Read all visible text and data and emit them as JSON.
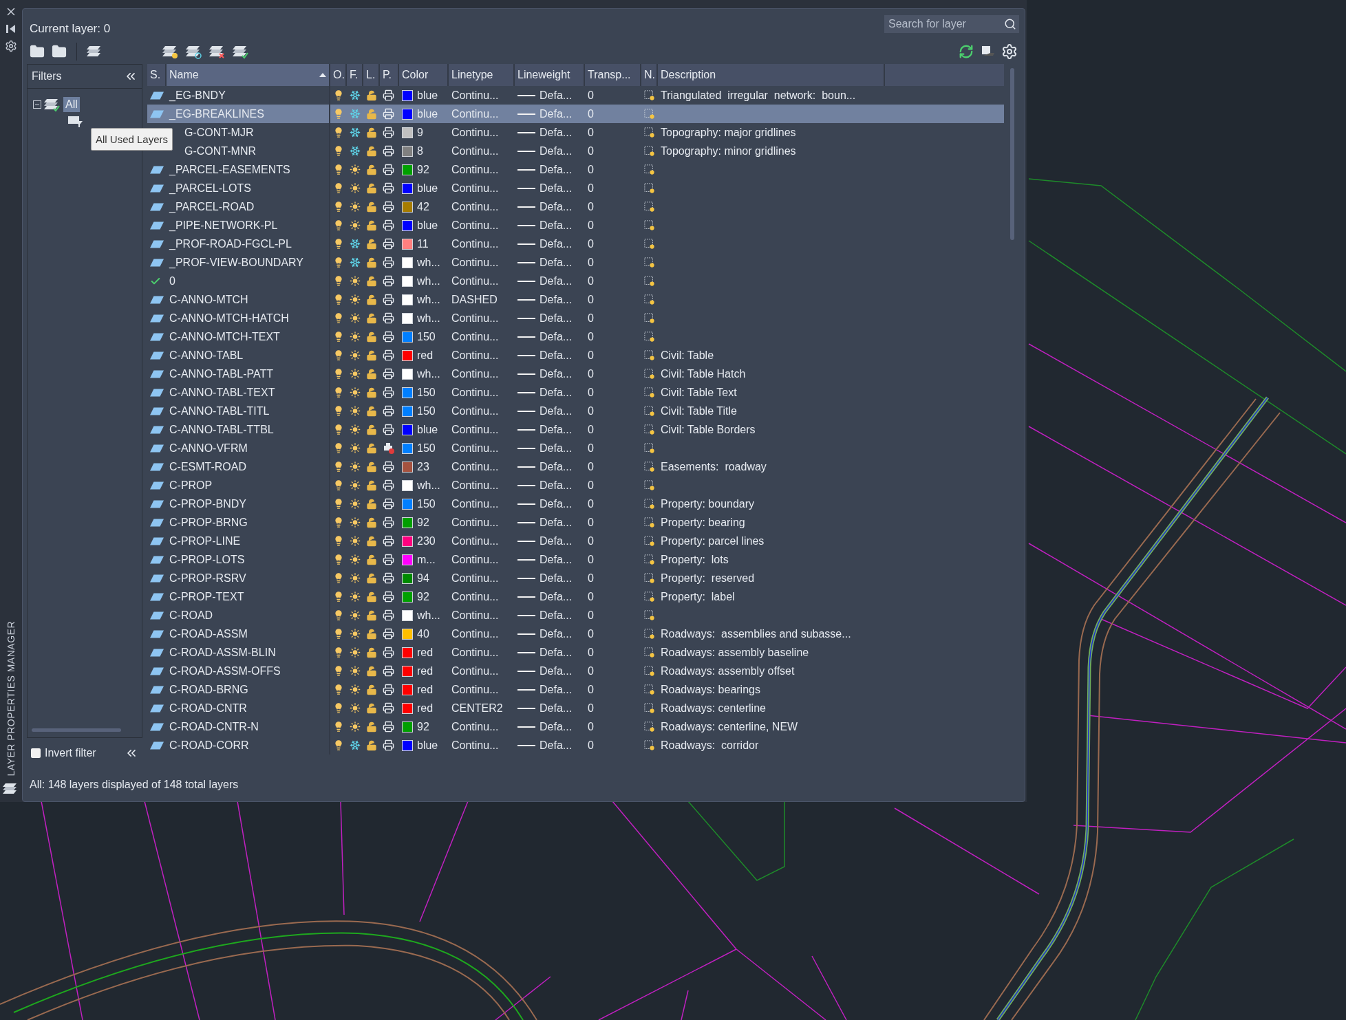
{
  "window": {
    "side_title": "LAYER PROPERTIES MANAGER"
  },
  "current_layer": "Current layer: 0",
  "search": {
    "placeholder": "Search for layer"
  },
  "filters": {
    "title": "Filters",
    "tree": [
      {
        "label": "All",
        "selected": true,
        "expanded": true,
        "children": [
          {
            "kind": "used-filter"
          }
        ]
      }
    ]
  },
  "tooltip": "All Used Layers",
  "invert_filter": {
    "label": "Invert filter",
    "checked": false
  },
  "columns": [
    {
      "label": "S.",
      "sorted": false
    },
    {
      "label": "Name",
      "sorted": true
    },
    {
      "label": "O.",
      "sorted": false
    },
    {
      "label": "F.",
      "sorted": false
    },
    {
      "label": "L.",
      "sorted": false
    },
    {
      "label": "P.",
      "sorted": false
    },
    {
      "label": "Color",
      "sorted": false
    },
    {
      "label": "Linetype",
      "sorted": false
    },
    {
      "label": "Lineweight",
      "sorted": false
    },
    {
      "label": "Transp...",
      "sorted": false
    },
    {
      "label": "N.",
      "sorted": false
    },
    {
      "label": "Description",
      "sorted": false
    }
  ],
  "rows": [
    {
      "kind": "layer",
      "name": "_EG-BNDY",
      "on": true,
      "frozen": true,
      "locked": false,
      "plot": true,
      "color": "#0000ff",
      "color_label": "blue",
      "linetype": "Continu...",
      "lineweight": "Defa...",
      "transparency": "0",
      "description": "Triangulated  irregular  network:  boun...",
      "selected": false
    },
    {
      "kind": "layer",
      "name": "_EG-BREAKLINES",
      "on": true,
      "frozen": true,
      "locked": false,
      "plot": true,
      "color": "#0000ff",
      "color_label": "blue",
      "linetype": "Continu...",
      "lineweight": "Defa...",
      "transparency": "0",
      "selected": true
    },
    {
      "kind": "covered",
      "name": "G-CONT-MJR",
      "on": true,
      "frozen": true,
      "locked": false,
      "plot": true,
      "color": "#c0c0c0",
      "color_label": "9",
      "linetype": "Continu...",
      "lineweight": "Defa...",
      "transparency": "0",
      "description": "Topography: major gridlines",
      "selected": false
    },
    {
      "kind": "covered",
      "name": "G-CONT-MNR",
      "on": true,
      "frozen": true,
      "locked": false,
      "plot": true,
      "color": "#808080",
      "color_label": "8",
      "linetype": "Continu...",
      "lineweight": "Defa...",
      "transparency": "0",
      "description": "Topography: minor gridlines",
      "selected": false
    },
    {
      "kind": "layer",
      "name": "_PARCEL-EASEMENTS",
      "on": true,
      "frozen": false,
      "locked": false,
      "plot": true,
      "color": "#00a000",
      "color_label": "92",
      "linetype": "Continu...",
      "lineweight": "Defa...",
      "transparency": "0",
      "selected": false
    },
    {
      "kind": "layer",
      "name": "_PARCEL-LOTS",
      "on": true,
      "frozen": false,
      "locked": false,
      "plot": true,
      "color": "#0000ff",
      "color_label": "blue",
      "linetype": "Continu...",
      "lineweight": "Defa...",
      "transparency": "0",
      "selected": false
    },
    {
      "kind": "layer",
      "name": "_PARCEL-ROAD",
      "on": true,
      "frozen": false,
      "locked": false,
      "plot": true,
      "color": "#a67c00",
      "color_label": "42",
      "linetype": "Continu...",
      "lineweight": "Defa...",
      "transparency": "0",
      "selected": false
    },
    {
      "kind": "layer",
      "name": "_PIPE-NETWORK-PL",
      "on": true,
      "frozen": false,
      "locked": false,
      "plot": true,
      "color": "#0000ff",
      "color_label": "blue",
      "linetype": "Continu...",
      "lineweight": "Defa...",
      "transparency": "0",
      "selected": false
    },
    {
      "kind": "layer",
      "name": "_PROF-ROAD-FGCL-PL",
      "on": true,
      "frozen": true,
      "locked": false,
      "plot": true,
      "color": "#ff7f7f",
      "color_label": "11",
      "linetype": "Continu...",
      "lineweight": "Defa...",
      "transparency": "0",
      "selected": false
    },
    {
      "kind": "layer",
      "name": "_PROF-VIEW-BOUNDARY",
      "on": true,
      "frozen": true,
      "locked": false,
      "plot": true,
      "color": "#ffffff",
      "color_label": "wh...",
      "linetype": "Continu...",
      "lineweight": "Defa...",
      "transparency": "0",
      "selected": false
    },
    {
      "kind": "current",
      "name": "0",
      "on": true,
      "frozen": false,
      "locked": false,
      "plot": true,
      "color": "#ffffff",
      "color_label": "wh...",
      "linetype": "Continu...",
      "lineweight": "Defa...",
      "transparency": "0",
      "selected": false
    },
    {
      "kind": "layer",
      "name": "C-ANNO-MTCH",
      "on": true,
      "frozen": false,
      "locked": false,
      "plot": true,
      "color": "#ffffff",
      "color_label": "wh...",
      "linetype": "DASHED",
      "lineweight": "Defa...",
      "transparency": "0",
      "selected": false
    },
    {
      "kind": "layer",
      "name": "C-ANNO-MTCH-HATCH",
      "on": true,
      "frozen": false,
      "locked": false,
      "plot": true,
      "color": "#ffffff",
      "color_label": "wh...",
      "linetype": "Continu...",
      "lineweight": "Defa...",
      "transparency": "0",
      "selected": false
    },
    {
      "kind": "layer",
      "name": "C-ANNO-MTCH-TEXT",
      "on": true,
      "frozen": false,
      "locked": false,
      "plot": true,
      "color": "#007fff",
      "color_label": "150",
      "linetype": "Continu...",
      "lineweight": "Defa...",
      "transparency": "0",
      "selected": false
    },
    {
      "kind": "layer",
      "name": "C-ANNO-TABL",
      "on": true,
      "frozen": false,
      "locked": false,
      "plot": true,
      "color": "#ff0000",
      "color_label": "red",
      "linetype": "Continu...",
      "lineweight": "Defa...",
      "transparency": "0",
      "description": "Civil: Table",
      "selected": false
    },
    {
      "kind": "layer",
      "name": "C-ANNO-TABL-PATT",
      "on": true,
      "frozen": false,
      "locked": false,
      "plot": true,
      "color": "#ffffff",
      "color_label": "wh...",
      "linetype": "Continu...",
      "lineweight": "Defa...",
      "transparency": "0",
      "description": "Civil: Table Hatch",
      "selected": false
    },
    {
      "kind": "layer",
      "name": "C-ANNO-TABL-TEXT",
      "on": true,
      "frozen": false,
      "locked": false,
      "plot": true,
      "color": "#007fff",
      "color_label": "150",
      "linetype": "Continu...",
      "lineweight": "Defa...",
      "transparency": "0",
      "description": "Civil: Table Text",
      "selected": false
    },
    {
      "kind": "layer",
      "name": "C-ANNO-TABL-TITL",
      "on": true,
      "frozen": false,
      "locked": false,
      "plot": true,
      "color": "#007fff",
      "color_label": "150",
      "linetype": "Continu...",
      "lineweight": "Defa...",
      "transparency": "0",
      "description": "Civil: Table Title",
      "selected": false
    },
    {
      "kind": "layer",
      "name": "C-ANNO-TABL-TTBL",
      "on": true,
      "frozen": false,
      "locked": false,
      "plot": true,
      "color": "#0000ff",
      "color_label": "blue",
      "linetype": "Continu...",
      "lineweight": "Defa...",
      "transparency": "0",
      "description": "Civil: Table Borders",
      "selected": false
    },
    {
      "kind": "layer",
      "name": "C-ANNO-VFRM",
      "on": true,
      "frozen": false,
      "locked": false,
      "plot": false,
      "color": "#007fff",
      "color_label": "150",
      "linetype": "Continu...",
      "lineweight": "Defa...",
      "transparency": "0",
      "selected": false
    },
    {
      "kind": "layer",
      "name": "C-ESMT-ROAD",
      "on": true,
      "frozen": false,
      "locked": false,
      "plot": true,
      "color": "#a5523f",
      "color_label": "23",
      "linetype": "Continu...",
      "lineweight": "Defa...",
      "transparency": "0",
      "description": "Easements:  roadway",
      "selected": false
    },
    {
      "kind": "layer",
      "name": "C-PROP",
      "on": true,
      "frozen": false,
      "locked": false,
      "plot": true,
      "color": "#ffffff",
      "color_label": "wh...",
      "linetype": "Continu...",
      "lineweight": "Defa...",
      "transparency": "0",
      "selected": false
    },
    {
      "kind": "layer",
      "name": "C-PROP-BNDY",
      "on": true,
      "frozen": false,
      "locked": false,
      "plot": true,
      "color": "#007fff",
      "color_label": "150",
      "linetype": "Continu...",
      "lineweight": "Defa...",
      "transparency": "0",
      "description": "Property: boundary",
      "selected": false
    },
    {
      "kind": "layer",
      "name": "C-PROP-BRNG",
      "on": true,
      "frozen": false,
      "locked": false,
      "plot": true,
      "color": "#00a000",
      "color_label": "92",
      "linetype": "Continu...",
      "lineweight": "Defa...",
      "transparency": "0",
      "description": "Property: bearing",
      "selected": false
    },
    {
      "kind": "layer",
      "name": "C-PROP-LINE",
      "on": true,
      "frozen": false,
      "locked": false,
      "plot": true,
      "color": "#ff007f",
      "color_label": "230",
      "linetype": "Continu...",
      "lineweight": "Defa...",
      "transparency": "0",
      "description": "Property: parcel lines",
      "selected": false
    },
    {
      "kind": "layer",
      "name": "C-PROP-LOTS",
      "on": true,
      "frozen": false,
      "locked": false,
      "plot": true,
      "color": "#ff00ff",
      "color_label": "m...",
      "linetype": "Continu...",
      "lineweight": "Defa...",
      "transparency": "0",
      "description": "Property:  lots",
      "selected": false
    },
    {
      "kind": "layer",
      "name": "C-PROP-RSRV",
      "on": true,
      "frozen": false,
      "locked": false,
      "plot": true,
      "color": "#008a00",
      "color_label": "94",
      "linetype": "Continu...",
      "lineweight": "Defa...",
      "transparency": "0",
      "description": "Property:  reserved",
      "selected": false
    },
    {
      "kind": "layer",
      "name": "C-PROP-TEXT",
      "on": true,
      "frozen": false,
      "locked": false,
      "plot": true,
      "color": "#00a000",
      "color_label": "92",
      "linetype": "Continu...",
      "lineweight": "Defa...",
      "transparency": "0",
      "description": "Property:  label",
      "selected": false
    },
    {
      "kind": "layer",
      "name": "C-ROAD",
      "on": true,
      "frozen": false,
      "locked": false,
      "plot": true,
      "color": "#ffffff",
      "color_label": "wh...",
      "linetype": "Continu...",
      "lineweight": "Defa...",
      "transparency": "0",
      "selected": false
    },
    {
      "kind": "layer",
      "name": "C-ROAD-ASSM",
      "on": true,
      "frozen": false,
      "locked": false,
      "plot": true,
      "color": "#ffbf00",
      "color_label": "40",
      "linetype": "Continu...",
      "lineweight": "Defa...",
      "transparency": "0",
      "description": "Roadways:  assemblies and subasse...",
      "selected": false
    },
    {
      "kind": "layer",
      "name": "C-ROAD-ASSM-BLIN",
      "on": true,
      "frozen": false,
      "locked": false,
      "plot": true,
      "color": "#ff0000",
      "color_label": "red",
      "linetype": "Continu...",
      "lineweight": "Defa...",
      "transparency": "0",
      "description": "Roadways: assembly baseline",
      "selected": false
    },
    {
      "kind": "layer",
      "name": "C-ROAD-ASSM-OFFS",
      "on": true,
      "frozen": false,
      "locked": false,
      "plot": true,
      "color": "#ff0000",
      "color_label": "red",
      "linetype": "Continu...",
      "lineweight": "Defa...",
      "transparency": "0",
      "description": "Roadways: assembly offset",
      "selected": false
    },
    {
      "kind": "layer",
      "name": "C-ROAD-BRNG",
      "on": true,
      "frozen": false,
      "locked": false,
      "plot": true,
      "color": "#ff0000",
      "color_label": "red",
      "linetype": "Continu...",
      "lineweight": "Defa...",
      "transparency": "0",
      "description": "Roadways: bearings",
      "selected": false
    },
    {
      "kind": "layer",
      "name": "C-ROAD-CNTR",
      "on": true,
      "frozen": false,
      "locked": false,
      "plot": true,
      "color": "#ff0000",
      "color_label": "red",
      "linetype": "CENTER2",
      "lineweight": "Defa...",
      "transparency": "0",
      "description": "Roadways: centerline",
      "selected": false
    },
    {
      "kind": "layer",
      "name": "C-ROAD-CNTR-N",
      "on": true,
      "frozen": false,
      "locked": false,
      "plot": true,
      "color": "#00a000",
      "color_label": "92",
      "linetype": "Continu...",
      "lineweight": "Defa...",
      "transparency": "0",
      "description": "Roadways: centerline, NEW",
      "selected": false
    },
    {
      "kind": "layer",
      "name": "C-ROAD-CORR",
      "on": true,
      "frozen": true,
      "locked": false,
      "plot": true,
      "color": "#0000ff",
      "color_label": "blue",
      "linetype": "Continu...",
      "lineweight": "Defa...",
      "transparency": "0",
      "description": "Roadways:  corridor",
      "selected": false
    }
  ],
  "status_bar": "All: 148 layers displayed of 148 total layers"
}
